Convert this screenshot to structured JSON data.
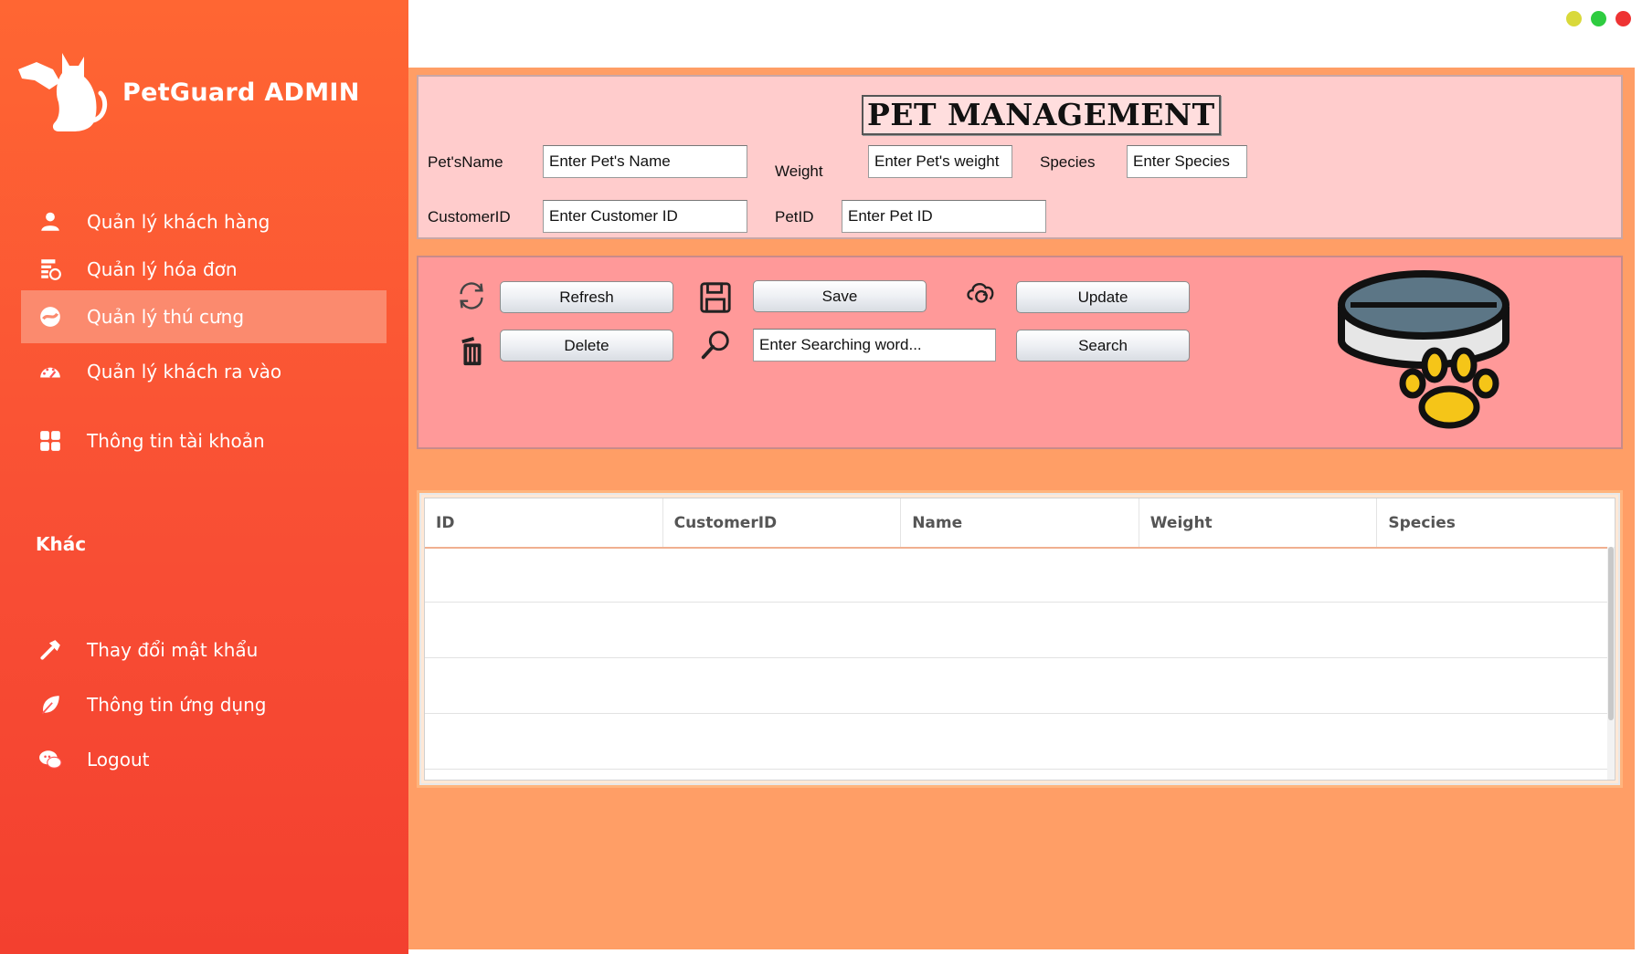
{
  "app": {
    "title": "PetGuard ADMIN"
  },
  "window_controls": [
    {
      "name": "minimize",
      "color": "#d9d93a"
    },
    {
      "name": "maximize",
      "color": "#2ecc40"
    },
    {
      "name": "close",
      "color": "#ee3333"
    }
  ],
  "sidebar": {
    "items": [
      {
        "label": "Quản lý khách hàng",
        "icon": "user-icon"
      },
      {
        "label": "Quản lý hóa đơn",
        "icon": "invoice-icon"
      },
      {
        "label": "Quản lý thú cưng",
        "icon": "pet-icon",
        "active": true
      },
      {
        "label": "Quản lý khách ra vào",
        "icon": "gauge-icon"
      },
      {
        "label": "Thông tin tài khoản",
        "icon": "grid-icon"
      }
    ],
    "section_label": "Khác",
    "other_items": [
      {
        "label": "Thay đổi mật khẩu",
        "icon": "hammer-icon"
      },
      {
        "label": "Thông tin ứng dụng",
        "icon": "leaf-icon"
      },
      {
        "label": "Logout",
        "icon": "chat-icon"
      }
    ]
  },
  "form": {
    "title": "PET MANAGEMENT",
    "pet_name_label": "Pet'sName",
    "pet_name_placeholder": "Enter Pet's Name",
    "weight_label": "Weight",
    "weight_placeholder": "Enter Pet's weight",
    "species_label": "Species",
    "species_placeholder": "Enter Species",
    "customer_id_label": "CustomerID",
    "customer_id_placeholder": "Enter Customer ID",
    "pet_id_label": "PetID",
    "pet_id_placeholder": "Enter Pet ID"
  },
  "actions": {
    "refresh_label": "Refresh",
    "save_label": "Save",
    "update_label": "Update",
    "delete_label": "Delete",
    "search_placeholder": "Enter Searching word...",
    "search_label": "Search"
  },
  "table": {
    "columns": [
      "ID",
      "CustomerID",
      "Name",
      "Weight",
      "Species"
    ],
    "rows": []
  },
  "colors": {
    "sidebar_top": "#ff6633",
    "sidebar_bottom": "#f3402f",
    "content_bg": "#ff9e66",
    "form_panel": "#ffcccc",
    "action_panel": "#ff9999"
  }
}
